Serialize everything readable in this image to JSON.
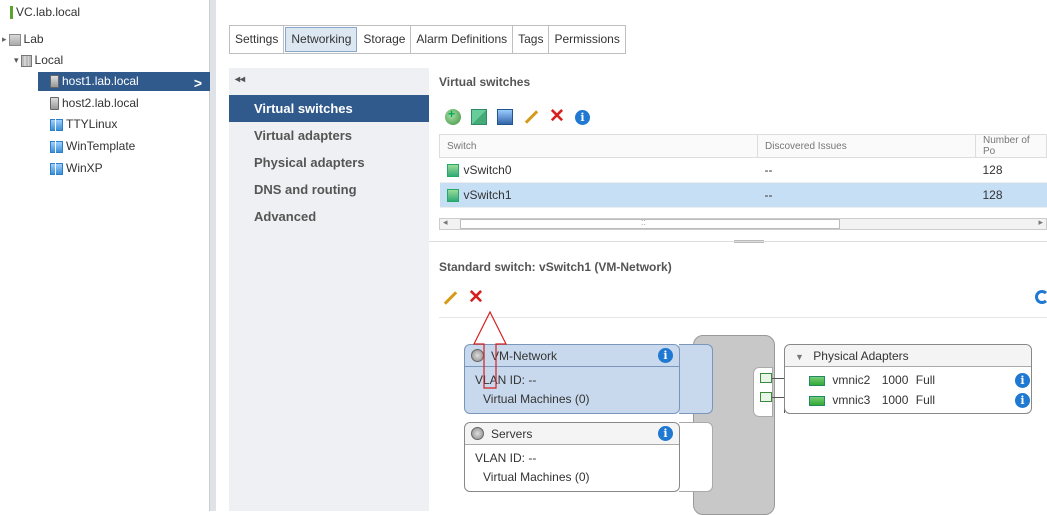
{
  "tree": {
    "items": [
      {
        "label": "VC.lab.local",
        "icon": "vcenter-icon"
      },
      {
        "label": "Lab",
        "icon": "datacenter-icon"
      },
      {
        "label": "Local",
        "icon": "cluster-icon"
      },
      {
        "label": "host1.lab.local",
        "icon": "host-icon"
      },
      {
        "label": "host2.lab.local",
        "icon": "host-icon"
      },
      {
        "label": "TTYLinux",
        "icon": "vm-icon"
      },
      {
        "label": "WinTemplate",
        "icon": "vm-icon"
      },
      {
        "label": "WinXP",
        "icon": "vm-icon"
      }
    ]
  },
  "tabs": [
    "Settings",
    "Networking",
    "Storage",
    "Alarm Definitions",
    "Tags",
    "Permissions"
  ],
  "subnav": {
    "collapse": "◂◂",
    "items": [
      "Virtual switches",
      "Virtual adapters",
      "Physical adapters",
      "DNS and routing",
      "Advanced"
    ]
  },
  "vswitches": {
    "title": "Virtual switches",
    "columns": [
      "Switch",
      "Discovered Issues",
      "Number of Po"
    ],
    "rows": [
      {
        "name": "vSwitch0",
        "issues": "--",
        "ports": "128"
      },
      {
        "name": "vSwitch1",
        "issues": "--",
        "ports": "128"
      }
    ],
    "scroll_grip": "::"
  },
  "detail": {
    "title": "Standard switch: vSwitch1 (VM-Network)",
    "portgroups": [
      {
        "name": "VM-Network",
        "vlan": "VLAN ID: --",
        "vms": "Virtual Machines (0)"
      },
      {
        "name": "Servers",
        "vlan": "VLAN ID: --",
        "vms": "Virtual Machines (0)"
      }
    ],
    "physical_adapters": {
      "title": "Physical Adapters",
      "nics": [
        {
          "name": "vmnic2",
          "speed": "1000",
          "duplex": "Full"
        },
        {
          "name": "vmnic3",
          "speed": "1000",
          "duplex": "Full"
        }
      ]
    }
  },
  "colors": {
    "selection": "#315a8c",
    "row_selected": "#c7dff5",
    "delete_red": "#d62020",
    "info_blue": "#1f78d1"
  }
}
